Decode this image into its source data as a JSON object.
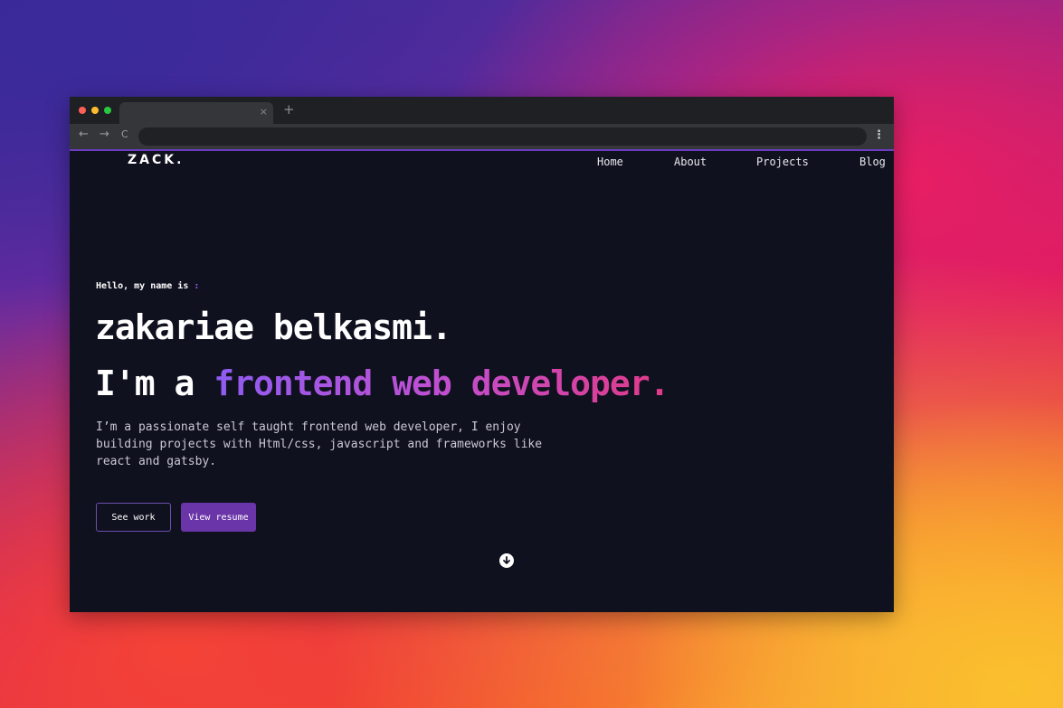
{
  "browser": {
    "tab_close": "×",
    "new_tab": "+",
    "back": "←",
    "forward": "→",
    "reload": "C",
    "menu": "⋮",
    "colors": {
      "close": "#ff5f57",
      "minimize": "#febc2e",
      "maximize": "#28c840"
    }
  },
  "site": {
    "logo": "ZACK.",
    "nav": [
      "Home",
      "About",
      "Projects",
      "Blog"
    ]
  },
  "hero": {
    "greeting": "Hello, my name is",
    "greeting_colon": ":",
    "name": "zakariae belkasmi.",
    "role_prefix": "I'm a ",
    "role_highlight": "frontend web developer.",
    "bio": "I’m a passionate self taught frontend web developer, I enjoy building projects with Html/css, javascript and frameworks like react and gatsby.",
    "buttons": {
      "see_work": "See work",
      "view_resume": "View resume"
    },
    "scroll_icon": "arrow-down-circle"
  },
  "colors": {
    "page_bg": "#10111f",
    "accent": "#6a35a8",
    "gradient_start": "#8e5cf2",
    "gradient_end": "#e23a87"
  }
}
